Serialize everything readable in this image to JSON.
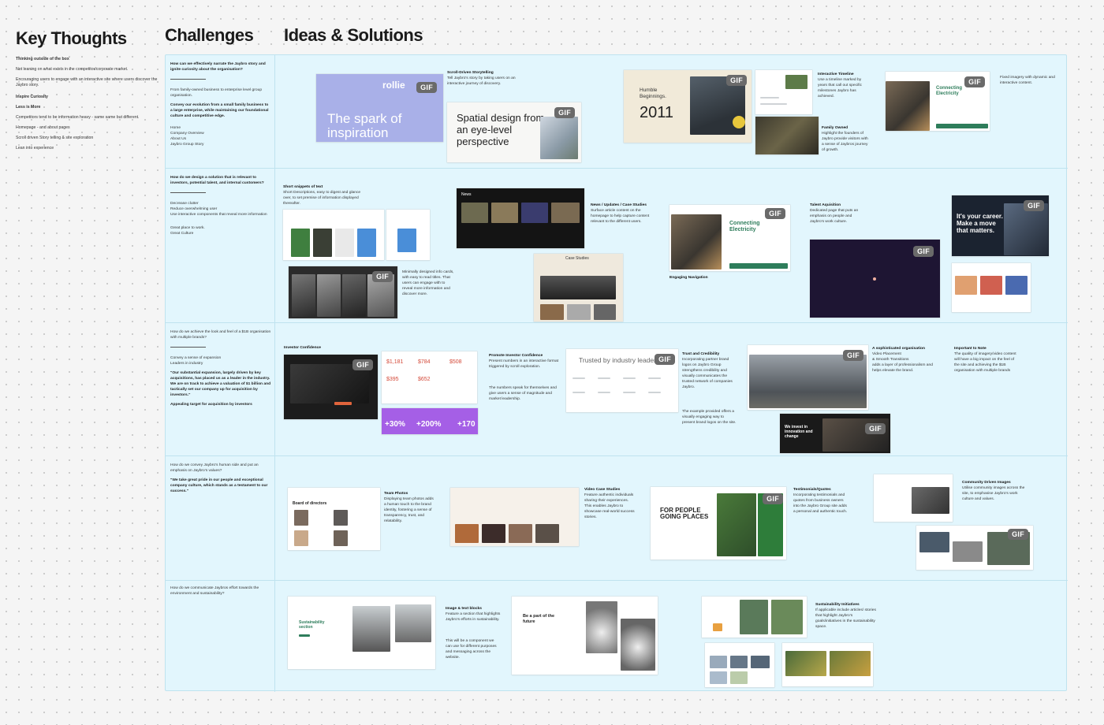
{
  "titles": {
    "key_thoughts": "Key Thoughts",
    "challenges": "Challenges",
    "ideas": "Ideas & Solutions"
  },
  "key_thoughts": [
    {
      "text": "Thinking outside of the box",
      "bold": true
    },
    {
      "text": "Not leaning on what exists in the competitor/corporate market.",
      "bold": false
    },
    {
      "text": "Encouraging users to engage with an interactive site where users discover the Jaybro story.",
      "bold": false
    },
    {
      "text": "Inspire Curiosity",
      "bold": true
    },
    {
      "text": "Less is More",
      "bold": true
    },
    {
      "text": "Competitors tend to be information heavy - same same but different.",
      "bold": false
    },
    {
      "text": "Homepage - and about pages",
      "bold": false
    },
    {
      "text": "Scroll driven Story telling & site exploration",
      "bold": false
    },
    {
      "text": "Lean into experience",
      "bold": false
    }
  ],
  "challenges": [
    {
      "q": "How can we effectively narrate the Jaybro story and ignite curiosity about the organisation?",
      "a": "From family-owned business to enterprise level group organisation.",
      "b": "Convey our evolution from a small family business to a large enterprise, while maintaining our foundational culture and competitive edge.",
      "c": "Home\nCompany Overview\nAbout Us\nJaybro Group Story"
    },
    {
      "q": "How do we design a solution that is relevant to investors, potential talent, and internal customers?",
      "a": "Decrease clutter\nReduce overwhelming user\nUse interactive components that reveal more information",
      "b": "",
      "c": "Great place to work.\nGreat Culture"
    },
    {
      "q": "How do we achieve the look and feel of a $1B organisation with multiple brands?",
      "a": "Convey a sense of expansion\nLeaders in industry",
      "b": "\"Our substantial expansion, largely driven by key acquisitions, has placed us as a leader in the industry. We are on track to achieve a valuation of $1 billion and tactically set our company up for acquisition by investors.\"",
      "c": "Appealing target for acquisition by investors"
    },
    {
      "q": "How do we convey Jaybro's human side and put an emphasis on Jaybro's values?",
      "a": "",
      "b": "\"We take great pride in our people and exceptional company culture, which stands as a testament to our success.\"",
      "c": ""
    },
    {
      "q": "How do we communicate Jaybros effort towards the environment and sustainability?",
      "a": "",
      "b": "",
      "c": ""
    }
  ],
  "notes": {
    "scroll": {
      "title": "Scroll-Driven Storytelling",
      "body": "Tell Jaybro's story by taking users on an interactive journey of discovery."
    },
    "timeline": {
      "title": "Interactive Timeline",
      "body": "Use a timeline marked by years that call out specific milestones Jaybro has achieved."
    },
    "family": {
      "title": "Family Owned",
      "body": "Highlight the founders of Jaybro provide visitors with a sense of Jaybros journey of growth."
    },
    "fixed": {
      "title": "",
      "body": "Fixed imagery with dynamic and interactive content."
    },
    "snippets": {
      "title": "Short snippets of text",
      "body": "Short Descriptions, easy to digest and glance over, to set premise of information displayed thereafter."
    },
    "minimal": {
      "title": "",
      "body": "Minimally designed info cards, with easy to read titles. That users can engage with to reveal more information and discover more."
    },
    "news": {
      "title": "News / Updates / Case Studies",
      "body": "Surface article content on the homepage to help capture content relevant to the different users."
    },
    "engaging": {
      "title": "Engaging Navigation",
      "body": ""
    },
    "talent": {
      "title": "Talent Aquisition",
      "body": "Dedicated page that puts an emphasis on people and Jaybro's work culture."
    },
    "investor": {
      "title": "Investor Confidence",
      "body": ""
    },
    "promote": {
      "title": "Promote Investor Confidence",
      "body": "Present numbers in an interactive format triggered by scroll exploration."
    },
    "promote2": {
      "title": "",
      "body": "The numbers speak for themselves and give users a sense of magnitude and market leadership."
    },
    "trust": {
      "title": "Trust and Credibility",
      "body": "Incorporating partner brand logos on Jaybro Group strengthens credibility and visually communicates the trusted network of companies Jaybro."
    },
    "trust2": {
      "title": "",
      "body": "The example provided offers a visually engaging way to present brand logos on the site."
    },
    "sophisticated": {
      "title": "A sophisticated organisation",
      "body": "Video Placement\n& Smooth Transitions\nadds a layer of professionalism and helps elevate the brand."
    },
    "important": {
      "title": "Important to Note",
      "body": "The quality of imagery/video content will have a big impact on the feel of the site and achieving the $1B organisation with multiple brands"
    },
    "team": {
      "title": "Team Photos",
      "body": "Displaying team photos adds a human touch to the brand identity, fostering a sense of transparency, trust, and relatability."
    },
    "video": {
      "title": "Video Case Studies",
      "body": "Feature authentic individuals sharing their experiences.\nThis enables Jaybro to showcase real-world success stories."
    },
    "testimonials": {
      "title": "Testimonials/Quotes",
      "body": "Incorporating testimonials and quotes from business owners into the Jaybro Group site adds a personal and authentic touch."
    },
    "community": {
      "title": "Community Driven Images",
      "body": "Utilise community images across the site, to emphasise Jaybro's work culture and values."
    },
    "image_text": {
      "title": "Image & text blocks",
      "body": "Feature a section that highlights Jaybro's efforts in sustainability."
    },
    "image_text2": {
      "title": "",
      "body": "This will be a component we can use for different purposes and messaging across the website."
    },
    "sustain": {
      "title": "Sustainability Initiatives",
      "body": "If applicable include articles/ stories that highlight Jaybro's goals/initiatives in the sustainability space."
    }
  },
  "mockups": {
    "rollie_logo": "rollie",
    "rollie_headline": "The spark of inspiration",
    "spatial_headline": "Spatial design from an eye-level perspective",
    "humble": "Humble Beginnings.",
    "year": "2011",
    "connecting": "Connecting Electricity",
    "career": "It's your career. Make a move that matters.",
    "case_studies": "Case Studies",
    "news_label": "News",
    "stat1": "$1,181",
    "stat2": "$784",
    "stat3": "$508",
    "stat4": "$395",
    "stat5": "$652",
    "pct1": "+30%",
    "pct2": "+200%",
    "pct3": "+170",
    "trusted": "Trusted by industry leaders",
    "board": "Board of directors",
    "for_people": "FOR PEOPLE GOING PLACES",
    "sustainability": "Sustainability section",
    "be_part": "Be a part of the future",
    "invest": "We invest in innovation and change",
    "gif": "GIF"
  },
  "colors": {
    "board": "#e2f6fd",
    "gif": "#6a6a6a",
    "rollie": "#a9b0e8",
    "purple": "#a55fe6",
    "green": "#2e7d5b",
    "dark": "#1e1533"
  }
}
